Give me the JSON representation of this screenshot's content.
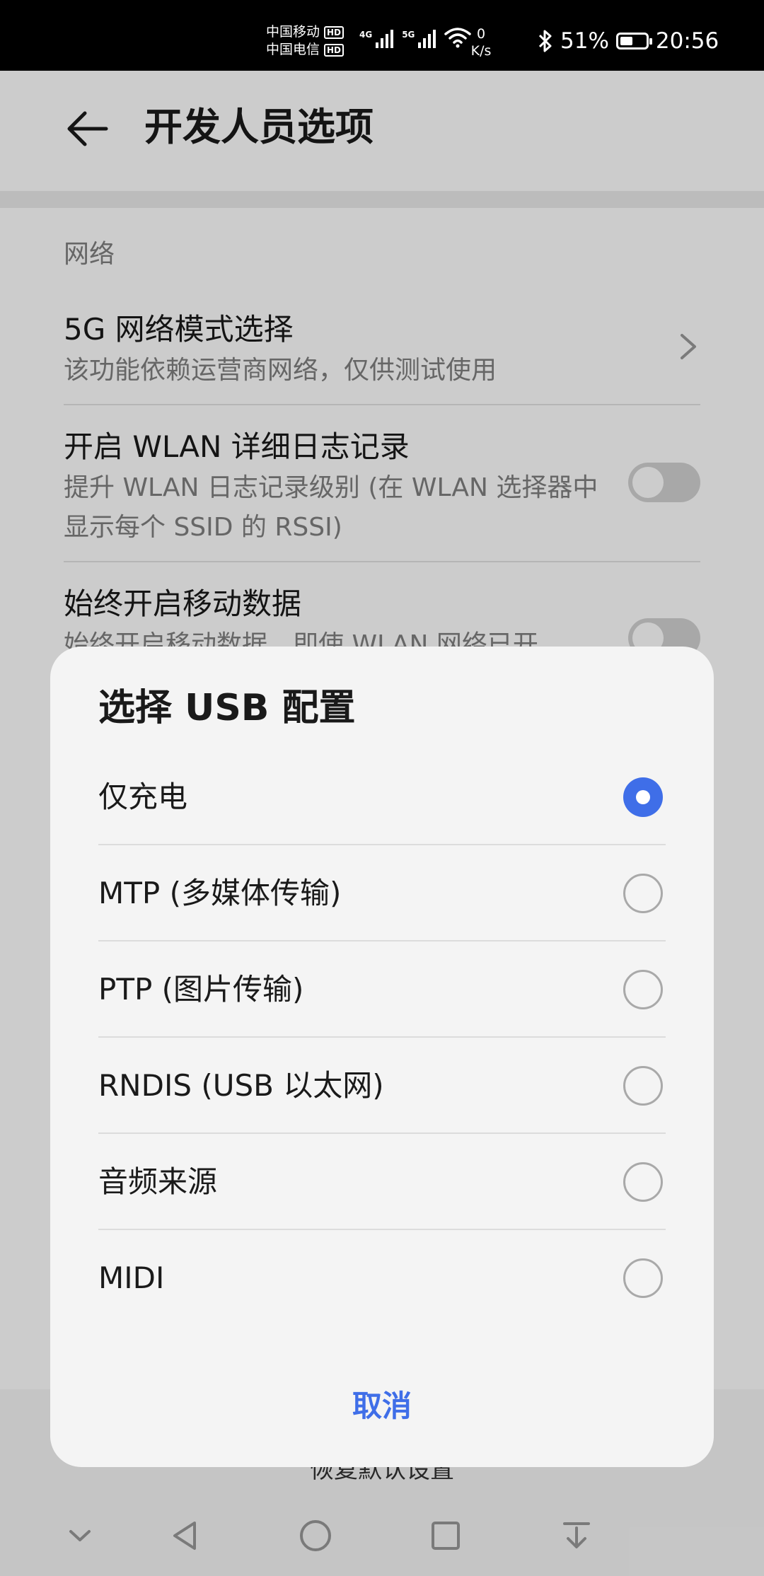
{
  "status_bar": {
    "carrier1": "中国移动",
    "carrier2": "中国电信",
    "hd": "HD",
    "sig1_type": "4G",
    "sig2_type": "5G",
    "net_speed_value": "0",
    "net_speed_unit": "K/s",
    "battery_percent": "51%",
    "battery_level": 0.51,
    "time": "20:56"
  },
  "header": {
    "title": "开发人员选项"
  },
  "settings": {
    "section_network": "网络",
    "item_5g": {
      "title": "5G 网络模式选择",
      "subtitle": "该功能依赖运营商网络，仅供测试使用"
    },
    "item_wlan_log": {
      "title": "开启 WLAN 详细日志记录",
      "subtitle": "提升 WLAN 日志记录级别 (在 WLAN 选择器中显示每个 SSID 的 RSSI)"
    },
    "item_mobile_data": {
      "title": "始终开启移动数据",
      "subtitle": "始终开启移动数据，即使 WLAN 网络已开"
    },
    "reset_label": "恢复默认设置"
  },
  "dialog": {
    "title": "选择 USB 配置",
    "options": [
      {
        "label": "仅充电",
        "selected": true
      },
      {
        "label": "MTP (多媒体传输)",
        "selected": false
      },
      {
        "label": "PTP (图片传输)",
        "selected": false
      },
      {
        "label": "RNDIS (USB 以太网)",
        "selected": false
      },
      {
        "label": "音频来源",
        "selected": false
      },
      {
        "label": "MIDI",
        "selected": false
      }
    ],
    "cancel_label": "取消"
  },
  "colors": {
    "accent": "#3f6ee8",
    "status_bar_bg": "#000000",
    "switch_off": "#d3d3d3"
  },
  "icons": {
    "back": "back-arrow-icon",
    "chevron": "chevron-right-icon",
    "bluetooth": "bluetooth-icon",
    "wifi": "wifi-icon",
    "battery": "battery-icon",
    "nav": [
      "collapse-down-icon",
      "nav-back-icon",
      "nav-home-icon",
      "nav-recents-icon",
      "notification-pulldown-icon"
    ]
  }
}
